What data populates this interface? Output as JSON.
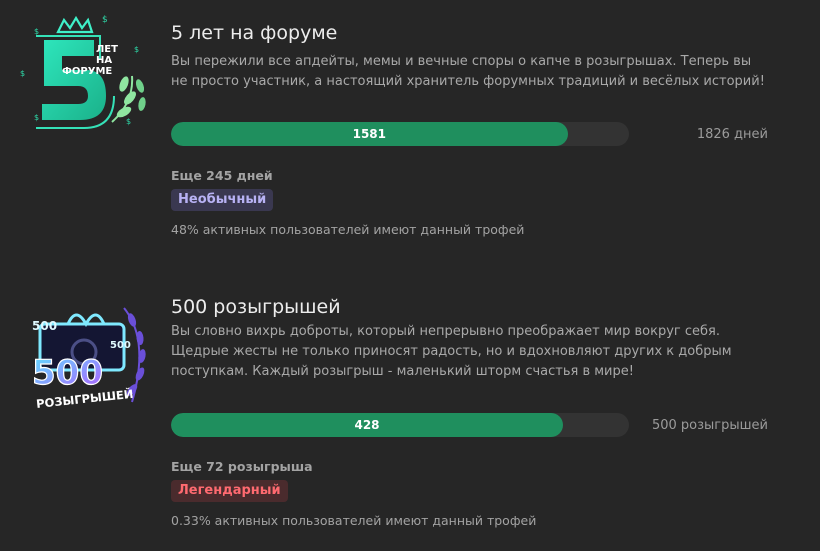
{
  "trophies": [
    {
      "title": "5 лет на форуме",
      "description": "Вы пережили все апдейты, мемы и вечные споры о капче в розыгрышах. Теперь вы не просто участник, а настоящий хранитель форумных традиций и весёлых историй!",
      "progress": {
        "current": "1581",
        "goal_label": "1826 дней",
        "fraction": 0.866
      },
      "remaining": "Еще 245 дней",
      "rarity": "Необычный",
      "stat": "48% активных пользователей имеют данный трофей",
      "badge": {
        "icon": "five-years-badge-icon",
        "text_line1": "ЛЕТ",
        "text_line2": "НА",
        "text_line3": "ФОРУМЕ",
        "number": "5"
      }
    },
    {
      "title": "500 розыгрышей",
      "description": "Вы словно вихрь доброты, который непрерывно преображает мир вокруг себя. Щедрые жесты не только приносят радость, но и вдохновляют других к добрым поступкам. Каждый розыгрыш - маленький шторм счастья в мире!",
      "progress": {
        "current": "428",
        "goal_label": "500 розыгрышей",
        "fraction": 0.856
      },
      "remaining": "Еще 72 розыгрыша",
      "rarity": "Легендарный",
      "stat": "0.33% активных пользователей имеют данный трофей",
      "badge": {
        "icon": "five-hundred-giveaways-badge-icon",
        "number": "500",
        "small_number": "500",
        "label": "РОЗЫГРЫШЕЙ"
      }
    }
  ],
  "colors": {
    "background": "#262626",
    "bar_fill": "#1f8f5e",
    "bar_track": "#333333",
    "uncommon": "#b8b2f4",
    "legendary": "#ff6a70"
  }
}
